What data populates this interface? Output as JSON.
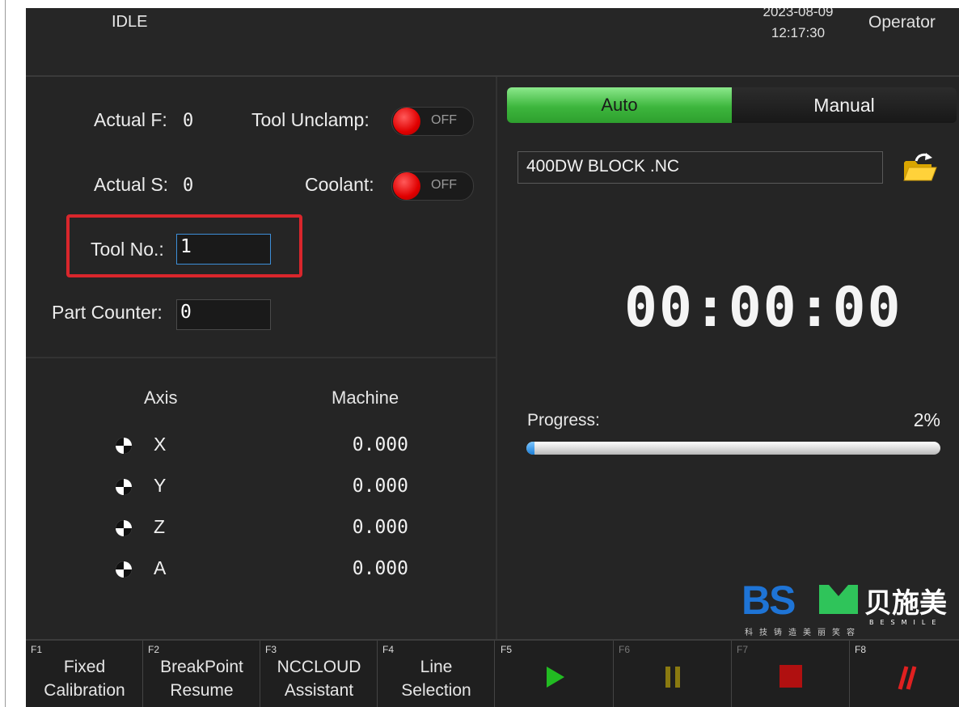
{
  "header": {
    "status": "IDLE",
    "date": "2023-08-09",
    "time": "12:17:30",
    "user": "Operator"
  },
  "left": {
    "actual_f": {
      "label": "Actual F:",
      "value": "0"
    },
    "actual_s": {
      "label": "Actual S:",
      "value": "0"
    },
    "tool_unclamp": {
      "label": "Tool Unclamp:",
      "state": "OFF"
    },
    "coolant": {
      "label": "Coolant:",
      "state": "OFF"
    },
    "tool_no": {
      "label": "Tool No.:",
      "value": "1"
    },
    "part_counter": {
      "label": "Part Counter:",
      "value": "0"
    },
    "axes": {
      "axis_header": "Axis",
      "machine_header": "Machine",
      "rows": [
        {
          "name": "X",
          "value": "0.000"
        },
        {
          "name": "Y",
          "value": "0.000"
        },
        {
          "name": "Z",
          "value": "0.000"
        },
        {
          "name": "A",
          "value": "0.000"
        }
      ]
    }
  },
  "right": {
    "modes": {
      "auto": "Auto",
      "manual": "Manual",
      "selected": "Auto"
    },
    "file_name": "400DW BLOCK .NC",
    "timer": "00:00:00",
    "progress": {
      "label": "Progress:",
      "value_text": "2%",
      "percent": 2
    },
    "logo": {
      "brand": "BSM",
      "cn_name": "贝施美",
      "en": "BESMILE",
      "cn_tagline": "科 技 铸 造 美 丽 笑 容"
    }
  },
  "function_keys": [
    {
      "key": "F1",
      "line1": "Fixed",
      "line2": "Calibration"
    },
    {
      "key": "F2",
      "line1": "BreakPoint",
      "line2": "Resume"
    },
    {
      "key": "F3",
      "line1": "NCCLOUD",
      "line2": "Assistant"
    },
    {
      "key": "F4",
      "line1": "Line",
      "line2": "Selection"
    },
    {
      "key": "F5",
      "icon": "play-icon"
    },
    {
      "key": "F6",
      "icon": "pause-icon"
    },
    {
      "key": "F7",
      "icon": "stop-icon"
    },
    {
      "key": "F8",
      "icon": "block-skip-icon"
    }
  ],
  "colors": {
    "auto_green": "#3db63d",
    "toggle_red": "#e00000",
    "highlight_red": "#d9262c",
    "progress_blue": "#1b7fd8",
    "play_green": "#22bb22",
    "pause_olive": "#8a7a10",
    "stop_red": "#b01010",
    "skip_red": "#e02020",
    "logo_blue": "#1e74d6",
    "logo_green": "#2fc45a"
  }
}
